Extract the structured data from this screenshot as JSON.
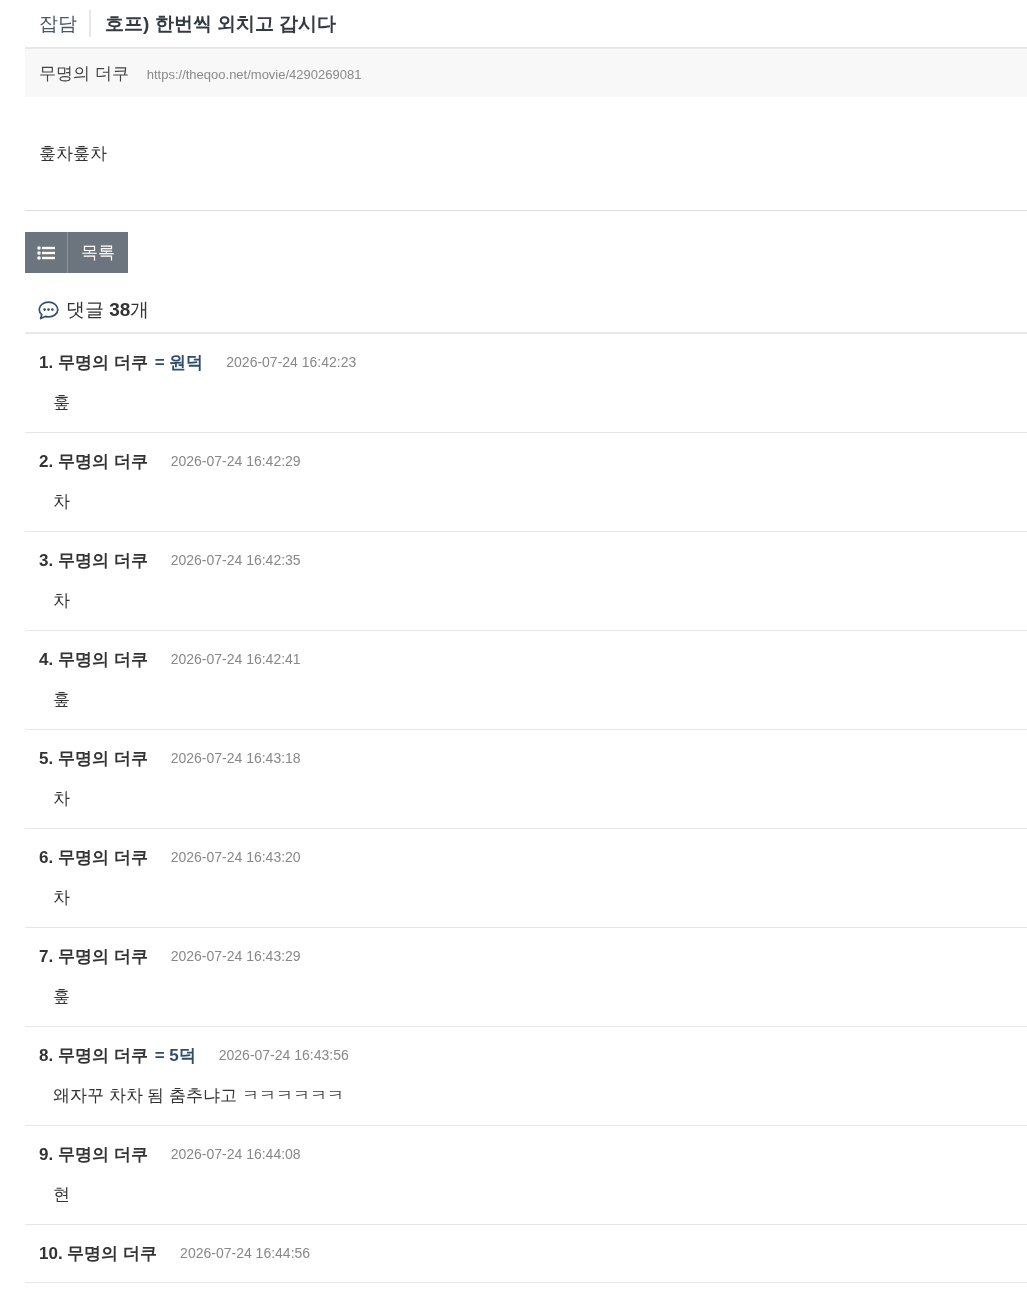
{
  "header": {
    "category": "잡담",
    "title": "호프) 한번씩 외치고 갑시다"
  },
  "meta": {
    "author": "무명의 더쿠",
    "url": "https://theqoo.net/movie/4290269081"
  },
  "body": "훞차훞차",
  "list_button": {
    "label": "목록"
  },
  "comments_heading": "댓글 **38**개",
  "comments": [
    {
      "number": "1.",
      "author": "무명의 더쿠",
      "tag": "= 원덕",
      "date": "2026-07-24 16:42:23",
      "text": "훞"
    },
    {
      "number": "2.",
      "author": "무명의 더쿠",
      "date": "2026-07-24 16:42:29",
      "text": "차"
    },
    {
      "number": "3.",
      "author": "무명의 더쿠",
      "date": "2026-07-24 16:42:35",
      "text": "차"
    },
    {
      "number": "4.",
      "author": "무명의 더쿠",
      "date": "2026-07-24 16:42:41",
      "text": "훞"
    },
    {
      "number": "5.",
      "author": "무명의 더쿠",
      "date": "2026-07-24 16:43:18",
      "text": "차"
    },
    {
      "number": "6.",
      "author": "무명의 더쿠",
      "date": "2026-07-24 16:43:20",
      "text": "차"
    },
    {
      "number": "7.",
      "author": "무명의 더쿠",
      "date": "2026-07-24 16:43:29",
      "text": "훞"
    },
    {
      "number": "8.",
      "author": "무명의 더쿠",
      "tag": "= 5덕",
      "date": "2026-07-24 16:43:56",
      "text": "왜자꾸 차차 됨 춤추냐고 ㅋㅋㅋㅋㅋㅋ"
    },
    {
      "number": "9.",
      "author": "무명의 더쿠",
      "date": "2026-07-24 16:44:08",
      "text": "현"
    },
    {
      "number": "10.",
      "author": "무명의 더쿠",
      "date": "2026-07-24 16:44:56"
    }
  ]
}
